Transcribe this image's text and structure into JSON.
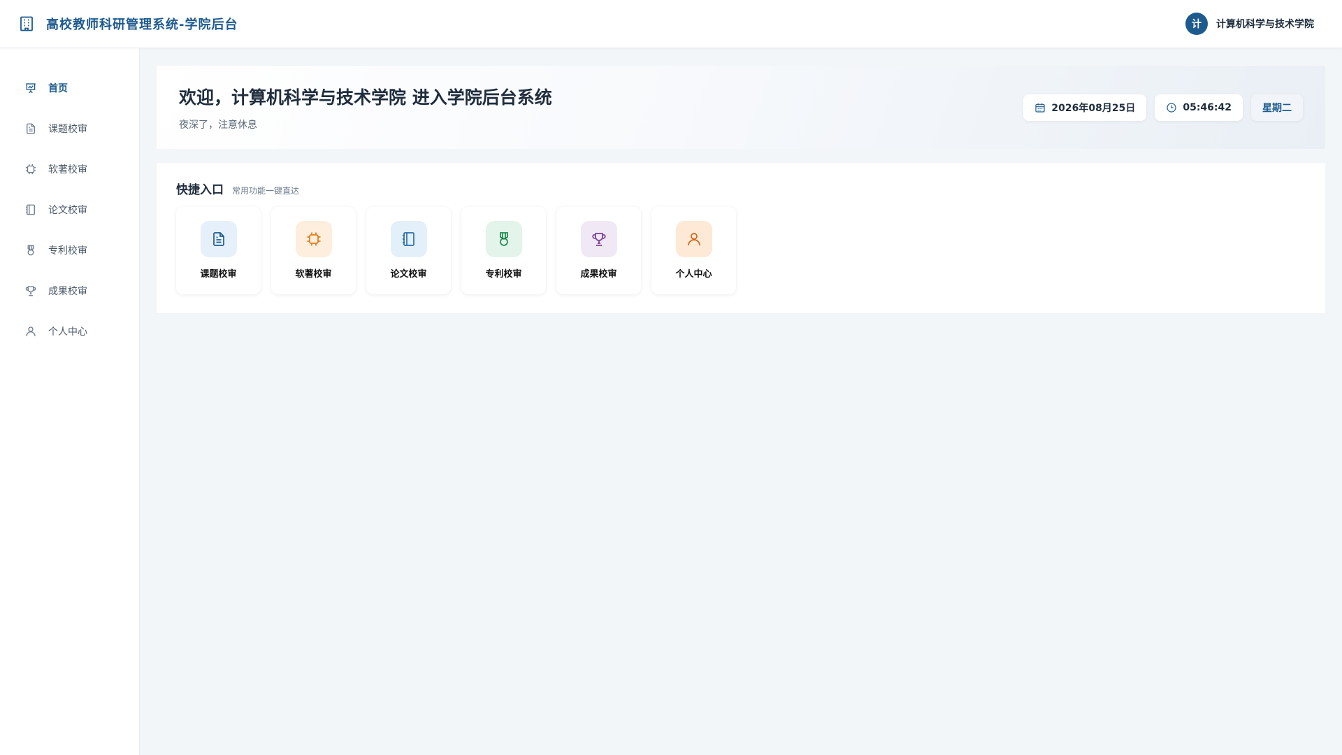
{
  "header": {
    "title": "高校教师科研管理系统-学院后台",
    "brand_icon": "building-icon",
    "user": {
      "avatar_text": "计",
      "name": "计算机科学与技术学院"
    }
  },
  "sidebar": {
    "items": [
      {
        "label": "首页",
        "icon": "presentation-chart-icon",
        "active": true
      },
      {
        "label": "课题校审",
        "icon": "document-icon"
      },
      {
        "label": "软著校审",
        "icon": "chip-icon"
      },
      {
        "label": "论文校审",
        "icon": "notebook-icon"
      },
      {
        "label": "专利校审",
        "icon": "medal-icon"
      },
      {
        "label": "成果校审",
        "icon": "trophy-icon"
      },
      {
        "label": "个人中心",
        "icon": "user-icon"
      }
    ]
  },
  "welcome": {
    "title": "欢迎，计算机科学与技术学院 进入学院后台系统",
    "subtitle": "夜深了，注意休息",
    "date": "2026年08月25日",
    "time": "05:46:42",
    "weekday": "星期二"
  },
  "quick": {
    "title": "快捷入口",
    "subtitle": "常用功能一键直达",
    "tiles": [
      {
        "label": "课题校审",
        "icon": "document-icon",
        "bg": "#e6f0fa",
        "fg": "#1d5a8e"
      },
      {
        "label": "软著校审",
        "icon": "chip-icon",
        "bg": "#fdeedd",
        "fg": "#e07b1a"
      },
      {
        "label": "论文校审",
        "icon": "notebook-icon",
        "bg": "#e3eff9",
        "fg": "#2a6fa8"
      },
      {
        "label": "专利校审",
        "icon": "medal-icon",
        "bg": "#e3f4ea",
        "fg": "#1f8a4c"
      },
      {
        "label": "成果校审",
        "icon": "trophy-icon",
        "bg": "#f1e8f5",
        "fg": "#7a3e94"
      },
      {
        "label": "个人中心",
        "icon": "user-icon",
        "bg": "#fde9d6",
        "fg": "#d0661a"
      }
    ]
  },
  "colors": {
    "primary": "#1d5a8e",
    "background": "#f3f6f9"
  }
}
